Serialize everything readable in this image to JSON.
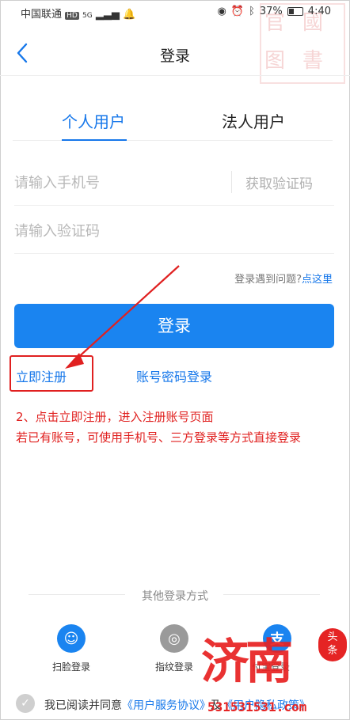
{
  "status_bar": {
    "carrier": "中国联通",
    "hd_badge": "HD",
    "network": "5G",
    "battery": "37%",
    "time": "4:40"
  },
  "nav": {
    "title": "登录",
    "back_icon": "chevron-left-icon"
  },
  "tabs": [
    {
      "label": "个人用户",
      "active": true
    },
    {
      "label": "法人用户",
      "active": false
    }
  ],
  "form": {
    "phone_placeholder": "请输入手机号",
    "get_code": "获取验证码",
    "code_placeholder": "请输入验证码",
    "help_text": "登录遇到问题?",
    "help_link": "点这里",
    "login_button": "登录"
  },
  "links": {
    "register": "立即注册",
    "password_login": "账号密码登录"
  },
  "annotation": {
    "line1": "2、点击立即注册，进入注册账号页面",
    "line2": "若已有账号，可使用手机号、三方登录等方式直接登录"
  },
  "other_login": {
    "title": "其他登录方式",
    "options": [
      {
        "label": "扫脸登录",
        "icon": "face-scan-icon"
      },
      {
        "label": "指纹登录",
        "icon": "fingerprint-icon"
      },
      {
        "label": "付宝登录",
        "icon": "alipay-icon"
      }
    ]
  },
  "agreement": {
    "prefix": "我已阅读并同意",
    "service": "《用户服务协议》",
    "mid": "及",
    "privacy": "《用户隐私政策》"
  },
  "watermark": {
    "big_text": "济南",
    "badge": "头条",
    "domain": "531531531.com"
  },
  "colors": {
    "accent": "#1a84f0",
    "annotation_red": "#e0201f"
  }
}
